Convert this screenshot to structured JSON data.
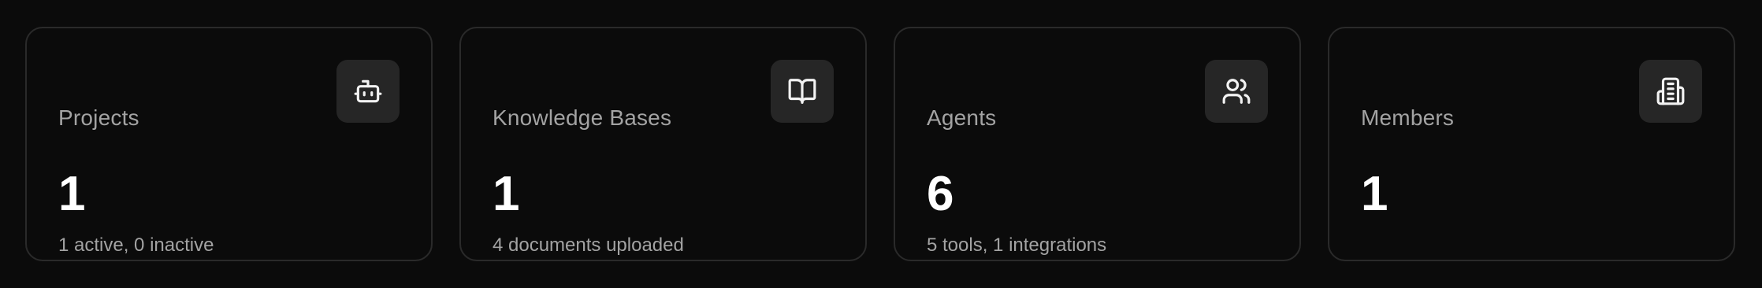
{
  "stats": [
    {
      "title": "Projects",
      "value": "1",
      "subtitle": "1 active, 0 inactive",
      "icon": "bot-icon"
    },
    {
      "title": "Knowledge Bases",
      "value": "1",
      "subtitle": "4 documents uploaded",
      "icon": "book-open-icon"
    },
    {
      "title": "Agents",
      "value": "6",
      "subtitle": "5 tools, 1 integrations",
      "icon": "users-icon"
    },
    {
      "title": "Members",
      "value": "1",
      "subtitle": "",
      "icon": "building-icon"
    }
  ],
  "colors": {
    "background": "#0b0b0b",
    "card_border": "#2a2a2a",
    "icon_box": "#262626",
    "muted_text": "#a3a3a3",
    "value_text": "#ffffff"
  }
}
